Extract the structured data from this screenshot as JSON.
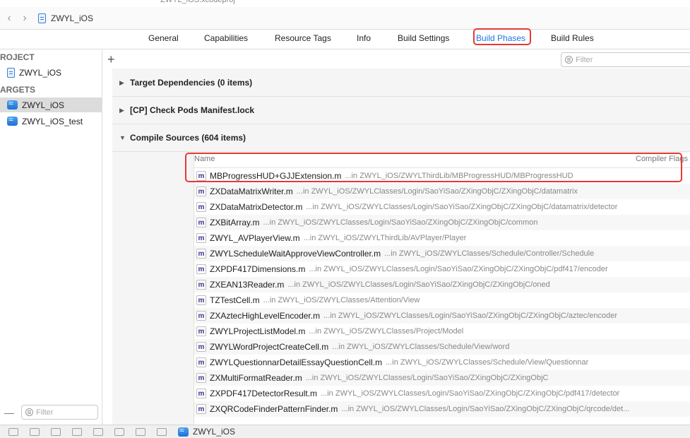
{
  "window": {
    "title": "ZWYL_iOS.xcodeproj"
  },
  "navbar": {
    "project_name": "ZWYL_iOS"
  },
  "tabs": [
    {
      "label": "General"
    },
    {
      "label": "Capabilities"
    },
    {
      "label": "Resource Tags"
    },
    {
      "label": "Info"
    },
    {
      "label": "Build Settings"
    },
    {
      "label": "Build Phases"
    },
    {
      "label": "Build Rules"
    }
  ],
  "sidebar": {
    "project_header": "ROJECT",
    "project_item": "ZWYL_iOS",
    "targets_header": "ARGETS",
    "targets": [
      {
        "label": "ZWYL_iOS"
      },
      {
        "label": "ZWYL_iOS_test"
      }
    ],
    "filter_placeholder": "Filter"
  },
  "content": {
    "add_symbol": "+",
    "filter_placeholder": "Filter",
    "phases": [
      {
        "title": "Target Dependencies (0 items)"
      },
      {
        "title": "[CP] Check Pods Manifest.lock"
      },
      {
        "title": "Compile Sources (604 items)"
      }
    ],
    "columns": {
      "name": "Name",
      "flags": "Compiler Flags"
    },
    "sources": [
      {
        "name": "MBProgressHUD+GJJExtension.m",
        "path": "...in ZWYL_iOS/ZWYLThirdLib/MBProgressHUD/MBProgressHUD"
      },
      {
        "name": "ZXDataMatrixWriter.m",
        "path": "...in ZWYL_iOS/ZWYLClasses/Login/SaoYiSao/ZXingObjC/ZXingObjC/datamatrix"
      },
      {
        "name": "ZXDataMatrixDetector.m",
        "path": "...in ZWYL_iOS/ZWYLClasses/Login/SaoYiSao/ZXingObjC/ZXingObjC/datamatrix/detector"
      },
      {
        "name": "ZXBitArray.m",
        "path": "...in ZWYL_iOS/ZWYLClasses/Login/SaoYiSao/ZXingObjC/ZXingObjC/common"
      },
      {
        "name": "ZWYL_AVPlayerView.m",
        "path": "...in ZWYL_iOS/ZWYLThirdLib/AVPlayer/Player"
      },
      {
        "name": "ZWYLScheduleWaitApproveViewController.m",
        "path": "...in ZWYL_iOS/ZWYLClasses/Schedule/Controller/Schedule"
      },
      {
        "name": "ZXPDF417Dimensions.m",
        "path": "...in ZWYL_iOS/ZWYLClasses/Login/SaoYiSao/ZXingObjC/ZXingObjC/pdf417/encoder"
      },
      {
        "name": "ZXEAN13Reader.m",
        "path": "...in ZWYL_iOS/ZWYLClasses/Login/SaoYiSao/ZXingObjC/ZXingObjC/oned"
      },
      {
        "name": "TZTestCell.m",
        "path": "...in ZWYL_iOS/ZWYLClasses/Attention/View"
      },
      {
        "name": "ZXAztecHighLevelEncoder.m",
        "path": "...in ZWYL_iOS/ZWYLClasses/Login/SaoYiSao/ZXingObjC/ZXingObjC/aztec/encoder"
      },
      {
        "name": "ZWYLProjectListModel.m",
        "path": "...in ZWYL_iOS/ZWYLClasses/Project/Model"
      },
      {
        "name": "ZWYLWordProjectCreateCell.m",
        "path": "...in ZWYL_iOS/ZWYLClasses/Schedule/View/word"
      },
      {
        "name": "ZWYLQuestionnarDetailEssayQuestionCell.m",
        "path": "...in ZWYL_iOS/ZWYLClasses/Schedule/View/Questionnar"
      },
      {
        "name": "ZXMultiFormatReader.m",
        "path": "...in ZWYL_iOS/ZWYLClasses/Login/SaoYiSao/ZXingObjC/ZXingObjC"
      },
      {
        "name": "ZXPDF417DetectorResult.m",
        "path": "...in ZWYL_iOS/ZWYLClasses/Login/SaoYiSao/ZXingObjC/ZXingObjC/pdf417/detector"
      },
      {
        "name": "ZXQRCodeFinderPatternFinder.m",
        "path": "...in ZWYL_iOS/ZWYLClasses/Login/SaoYiSao/ZXingObjC/ZXingObjC/qrcode/det..."
      }
    ]
  },
  "statusbar": {
    "scheme": "ZWYL_iOS"
  },
  "colors": {
    "accent": "#1a76e2",
    "highlight": "#e53935",
    "selection": "#dcdcdc"
  }
}
